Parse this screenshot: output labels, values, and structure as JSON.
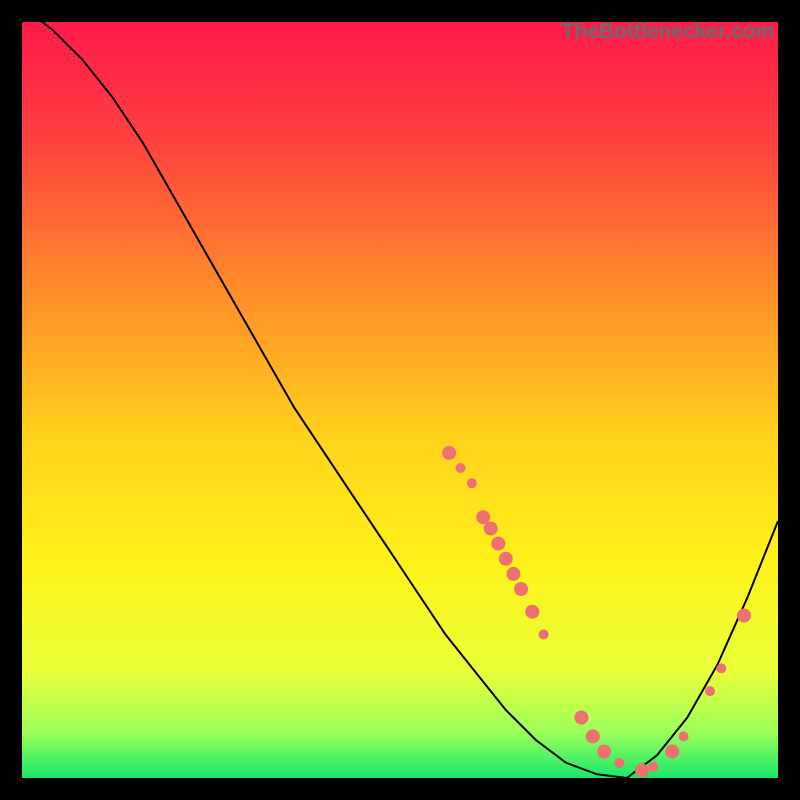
{
  "attribution": "TheBottlenecker.com",
  "chart_data": {
    "type": "line",
    "title": "",
    "xlabel": "",
    "ylabel": "",
    "xlim": [
      0,
      100
    ],
    "ylim": [
      0,
      100
    ],
    "grid": false,
    "background_gradient": {
      "stops": [
        {
          "offset": 0.0,
          "color": "#ff1a4a"
        },
        {
          "offset": 0.15,
          "color": "#ff3f3f"
        },
        {
          "offset": 0.35,
          "color": "#ff8a2a"
        },
        {
          "offset": 0.55,
          "color": "#ffd21c"
        },
        {
          "offset": 0.72,
          "color": "#fff31a"
        },
        {
          "offset": 0.86,
          "color": "#e8ff3a"
        },
        {
          "offset": 0.94,
          "color": "#9bff5a"
        },
        {
          "offset": 1.0,
          "color": "#17e86a"
        }
      ]
    },
    "series": [
      {
        "name": "bottleneck-curve",
        "color": "#000000",
        "width": 2,
        "x": [
          0,
          4,
          8,
          12,
          16,
          20,
          24,
          28,
          32,
          36,
          40,
          44,
          48,
          52,
          56,
          60,
          64,
          68,
          72,
          76,
          80,
          84,
          88,
          92,
          96,
          100
        ],
        "y": [
          102,
          99,
          95,
          90,
          84,
          77,
          70,
          63,
          56,
          49,
          43,
          37,
          31,
          25,
          19,
          14,
          9,
          5,
          2,
          0.5,
          0,
          3,
          8,
          15,
          24,
          34
        ]
      }
    ],
    "scatter_clusters": [
      {
        "name": "curve-dots",
        "color": "#ef7070",
        "radius_small": 5,
        "radius_large": 7,
        "points": [
          {
            "x": 56.5,
            "y": 43.0,
            "r": "large"
          },
          {
            "x": 58.0,
            "y": 41.0,
            "r": "small"
          },
          {
            "x": 59.5,
            "y": 39.0,
            "r": "small"
          },
          {
            "x": 61.0,
            "y": 34.5,
            "r": "large"
          },
          {
            "x": 62.0,
            "y": 33.0,
            "r": "large"
          },
          {
            "x": 63.0,
            "y": 31.0,
            "r": "large"
          },
          {
            "x": 64.0,
            "y": 29.0,
            "r": "large"
          },
          {
            "x": 65.0,
            "y": 27.0,
            "r": "large"
          },
          {
            "x": 66.0,
            "y": 25.0,
            "r": "large"
          },
          {
            "x": 67.5,
            "y": 22.0,
            "r": "large"
          },
          {
            "x": 69.0,
            "y": 19.0,
            "r": "small"
          },
          {
            "x": 74.0,
            "y": 8.0,
            "r": "large"
          },
          {
            "x": 75.5,
            "y": 5.5,
            "r": "large"
          },
          {
            "x": 77.0,
            "y": 3.5,
            "r": "large"
          },
          {
            "x": 79.0,
            "y": 2.0,
            "r": "small"
          },
          {
            "x": 82.0,
            "y": 1.0,
            "r": "large"
          },
          {
            "x": 83.5,
            "y": 1.5,
            "r": "small"
          },
          {
            "x": 86.0,
            "y": 3.5,
            "r": "large"
          },
          {
            "x": 87.5,
            "y": 5.5,
            "r": "small"
          },
          {
            "x": 91.0,
            "y": 11.5,
            "r": "small"
          },
          {
            "x": 92.5,
            "y": 14.5,
            "r": "small"
          },
          {
            "x": 95.5,
            "y": 21.5,
            "r": "large"
          }
        ]
      }
    ]
  }
}
